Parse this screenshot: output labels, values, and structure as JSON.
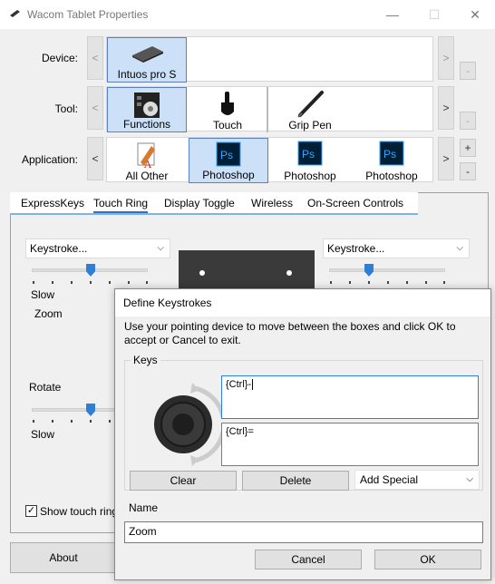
{
  "window": {
    "title": "Wacom Tablet Properties",
    "minimize": "—",
    "maximize": "☐",
    "close": "✕"
  },
  "device": {
    "label": "Device:",
    "left_btn": "<",
    "right_btn": ">",
    "remove_btn": "-",
    "items": [
      {
        "label": "Intuos pro S",
        "icon": "tablet-icon"
      }
    ]
  },
  "tool": {
    "label": "Tool:",
    "left_btn": "<",
    "right_btn": ">",
    "remove_btn": "-",
    "items": [
      {
        "label": "Functions",
        "icon": "functions-icon"
      },
      {
        "label": "Touch",
        "icon": "touch-hand-icon"
      },
      {
        "label": "Grip Pen",
        "icon": "pen-icon"
      }
    ]
  },
  "application": {
    "label": "Application:",
    "left_btn": "<",
    "right_btn": ">",
    "add_btn": "+",
    "remove_btn": "-",
    "items": [
      {
        "label": "All Other",
        "icon": "all-other-icon"
      },
      {
        "label": "Photoshop",
        "icon": "photoshop-icon",
        "badge": "Ps"
      },
      {
        "label": "Photoshop",
        "icon": "photoshop-icon",
        "badge": "Ps"
      },
      {
        "label": "Photoshop",
        "icon": "photoshop-icon",
        "badge": "Ps"
      }
    ]
  },
  "tabs": [
    "ExpressKeys",
    "Touch Ring",
    "Display Toggle",
    "Wireless",
    "On-Screen Controls"
  ],
  "touch_ring": {
    "left_combo": "Keystroke...",
    "right_combo": "Keystroke...",
    "slow_label_1": "Slow",
    "zoom_label": "Zoom",
    "rotate_combo": "Rotate",
    "slow_label_2": "Slow",
    "show_touch_ring": "Show touch ring",
    "speed_fraction": 0.5
  },
  "about_button": "About",
  "colors": {
    "selection": "#cce0f8",
    "photoshop_bg": "#001e36",
    "photoshop_fg": "#31a8ff",
    "accent": "#2f7fd9"
  },
  "dialog": {
    "title": "Define Keystrokes",
    "description": "Use your pointing device to move between the boxes and click OK to accept or Cancel to exit.",
    "keys_group": "Keys",
    "key1": "{Ctrl}-",
    "key2": "{Ctrl}=",
    "clear": "Clear",
    "delete": "Delete",
    "add_special": "Add Special",
    "name_label": "Name",
    "name_value": "Zoom",
    "cancel": "Cancel",
    "ok": "OK"
  }
}
